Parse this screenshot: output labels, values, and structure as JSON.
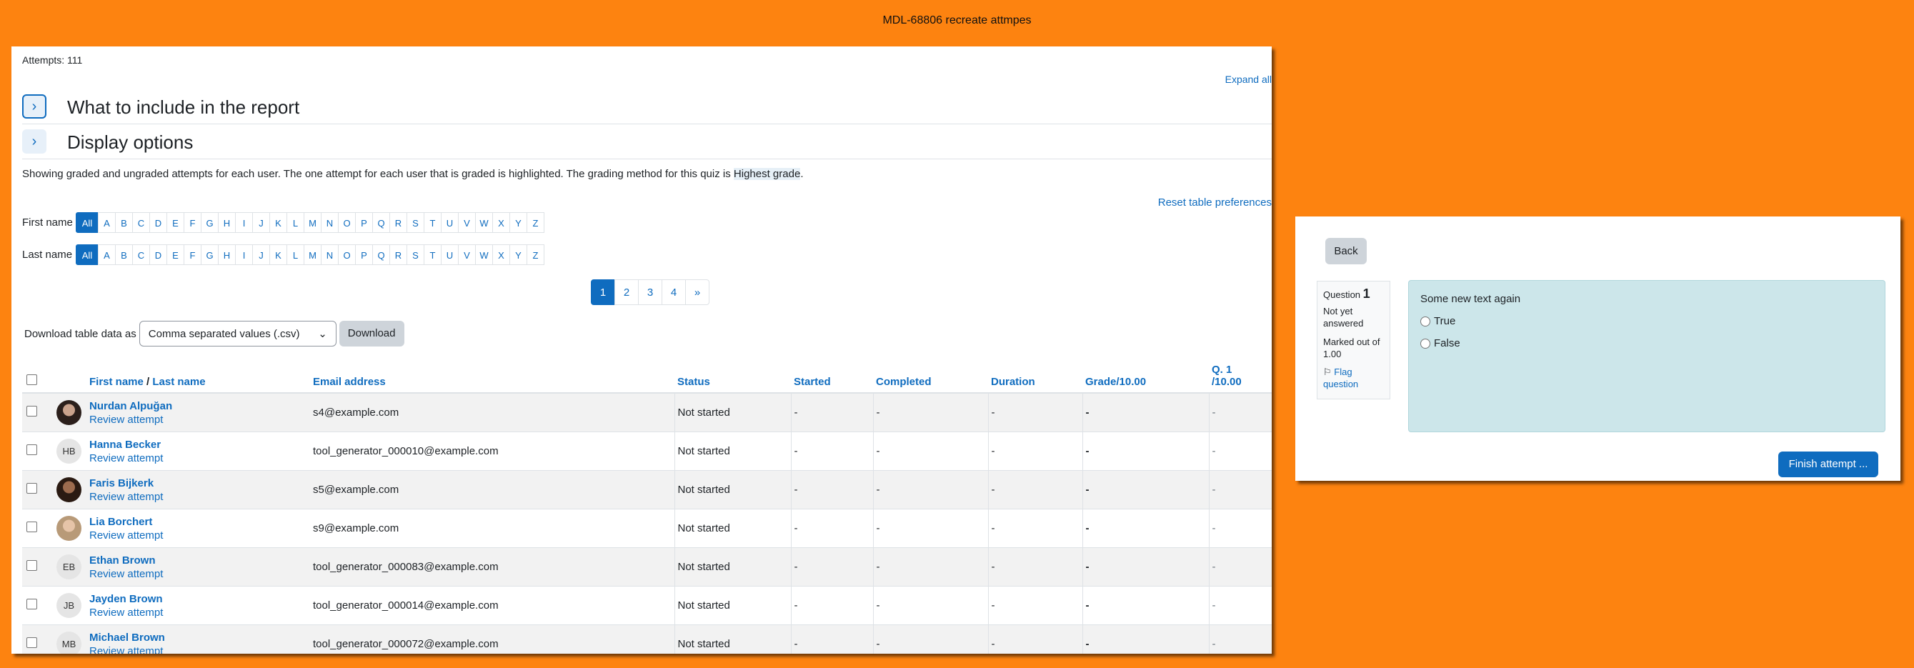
{
  "window_title": "MDL-68806 recreate attmpes",
  "report": {
    "attempts_label": "Attempts: 111",
    "expand_all": "Expand all",
    "sections": [
      {
        "title": "What to include in the report"
      },
      {
        "title": "Display options"
      }
    ],
    "description_prefix": "Showing graded and ungraded attempts for each user. The one attempt for each user that is graded is highlighted. The grading method for this quiz is ",
    "grading_method": "Highest grade",
    "description_suffix": ".",
    "reset_link": "Reset table preferences",
    "first_name_label": "First name",
    "last_name_label": "Last name",
    "all_label": "All",
    "letters": [
      "A",
      "B",
      "C",
      "D",
      "E",
      "F",
      "G",
      "H",
      "I",
      "J",
      "K",
      "L",
      "M",
      "N",
      "O",
      "P",
      "Q",
      "R",
      "S",
      "T",
      "U",
      "V",
      "W",
      "X",
      "Y",
      "Z"
    ],
    "pagination": [
      "1",
      "2",
      "3",
      "4",
      "»"
    ],
    "current_page": "1",
    "download_label": "Download table data as",
    "download_format": "Comma separated values (.csv)",
    "download_button": "Download",
    "columns": {
      "first_name": "First name",
      "separator": "/",
      "last_name": "Last name",
      "email": "Email address",
      "status": "Status",
      "started": "Started",
      "completed": "Completed",
      "duration": "Duration",
      "grade": "Grade/10.00",
      "q1_line1": "Q. 1",
      "q1_line2": "/10.00"
    },
    "review_label": "Review attempt",
    "rows": [
      {
        "initials": "",
        "name": "Nurdan Alpuğan",
        "email": "s4@example.com",
        "status": "Not started",
        "started": "-",
        "completed": "-",
        "duration": "-",
        "grade": "-",
        "q1": "-"
      },
      {
        "initials": "HB",
        "name": "Hanna Becker",
        "email": "tool_generator_000010@example.com",
        "status": "Not started",
        "started": "-",
        "completed": "-",
        "duration": "-",
        "grade": "-",
        "q1": "-"
      },
      {
        "initials": "",
        "name": "Faris Bijkerk",
        "email": "s5@example.com",
        "status": "Not started",
        "started": "-",
        "completed": "-",
        "duration": "-",
        "grade": "-",
        "q1": "-"
      },
      {
        "initials": "",
        "name": "Lia Borchert",
        "email": "s9@example.com",
        "status": "Not started",
        "started": "-",
        "completed": "-",
        "duration": "-",
        "grade": "-",
        "q1": "-"
      },
      {
        "initials": "EB",
        "name": "Ethan Brown",
        "email": "tool_generator_000083@example.com",
        "status": "Not started",
        "started": "-",
        "completed": "-",
        "duration": "-",
        "grade": "-",
        "q1": "-"
      },
      {
        "initials": "JB",
        "name": "Jayden Brown",
        "email": "tool_generator_000014@example.com",
        "status": "Not started",
        "started": "-",
        "completed": "-",
        "duration": "-",
        "grade": "-",
        "q1": "-"
      },
      {
        "initials": "MB",
        "name": "Michael Brown",
        "email": "tool_generator_000072@example.com",
        "status": "Not started",
        "started": "-",
        "completed": "-",
        "duration": "-",
        "grade": "-",
        "q1": "-"
      }
    ]
  },
  "quiz": {
    "back_label": "Back",
    "question_word": "Question",
    "question_number": "1",
    "state": "Not yet answered",
    "marked_out_of": "Marked out of 1.00",
    "flag_label": "Flag question",
    "question_text": "Some new text again",
    "options": [
      "True",
      "False"
    ],
    "finish_label": "Finish attempt ..."
  }
}
